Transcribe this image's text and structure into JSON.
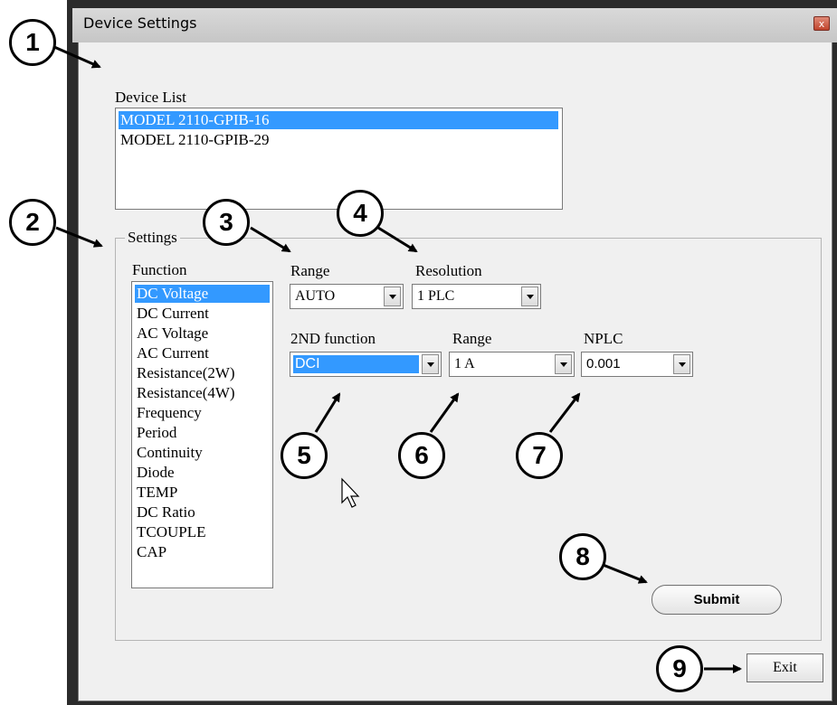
{
  "window": {
    "title": "Device Settings",
    "close_glyph": "x"
  },
  "device_list": {
    "label": "Device List",
    "items": [
      "MODEL 2110-GPIB-16",
      "MODEL 2110-GPIB-29"
    ],
    "selected_index": 0
  },
  "settings": {
    "group_label": "Settings",
    "function": {
      "label": "Function",
      "items": [
        "DC Voltage",
        "DC Current",
        "AC Voltage",
        "AC Current",
        "Resistance(2W)",
        "Resistance(4W)",
        "Frequency",
        "Period",
        "Continuity",
        "Diode",
        "TEMP",
        "DC Ratio",
        "TCOUPLE",
        "CAP"
      ],
      "selected_index": 0
    },
    "range": {
      "label": "Range",
      "value": "AUTO"
    },
    "resolution": {
      "label": "Resolution",
      "value": "1 PLC"
    },
    "second_function": {
      "label": "2ND function",
      "value": "DCI"
    },
    "second_range": {
      "label": "Range",
      "value": "1 A"
    },
    "nplc": {
      "label": "NPLC",
      "value": "0.001"
    },
    "submit_label": "Submit"
  },
  "exit_label": "Exit",
  "callouts": [
    "1",
    "2",
    "3",
    "4",
    "5",
    "6",
    "7",
    "8",
    "9"
  ],
  "colors": {
    "selection": "#3399ff",
    "dialog_bg": "#f0f0f0",
    "window_frame": "#2b2b2b"
  }
}
